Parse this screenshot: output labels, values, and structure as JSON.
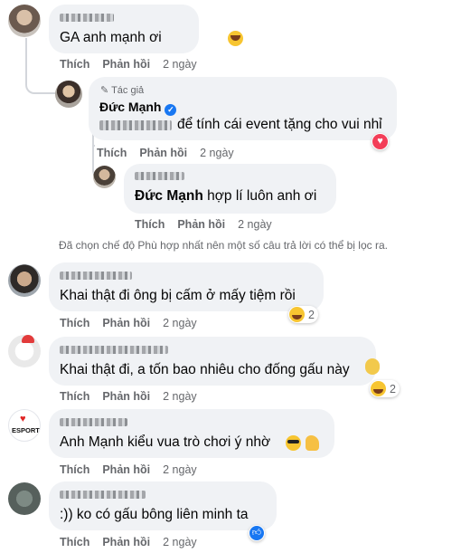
{
  "actions": {
    "like": "Thích",
    "reply": "Phản hồi"
  },
  "author_badge": "Tác giả",
  "filter_notice": "Đã chọn chế độ Phù hợp nhất nên một số câu trả lời có thể bị lọc ra.",
  "comments": [
    {
      "text": "GA anh mạnh ơi",
      "time": "2 ngày"
    },
    {
      "author": "Đức Mạnh",
      "text_suffix": "để tính cái event tặng cho vui nhỉ",
      "time": "2 ngày",
      "reaction": "love"
    },
    {
      "mention": "Đức Mạnh",
      "text": "hợp lí luôn anh ơi",
      "time": "2 ngày"
    },
    {
      "text": "Khai thật đi ông bị cấm ở mấy tiệm rồi",
      "time": "2 ngày",
      "reaction_count": "2"
    },
    {
      "text": "Khai thật đi, a tốn bao nhiêu cho đống gấu này",
      "time": "2 ngày",
      "reaction_count": "2"
    },
    {
      "text": "Anh Mạnh kiểu vua trò chơi ý nhờ",
      "time": "2 ngày",
      "avatar_text": "ESPORT"
    },
    {
      "text": ":)) ko có gấu bông liên minh ta",
      "time": "2 ngày"
    }
  ],
  "colors": {
    "bubble": "#f0f2f5",
    "meta": "#65676b",
    "verified": "#1877f2",
    "love": "#f33e58",
    "like": "#1877f2"
  }
}
